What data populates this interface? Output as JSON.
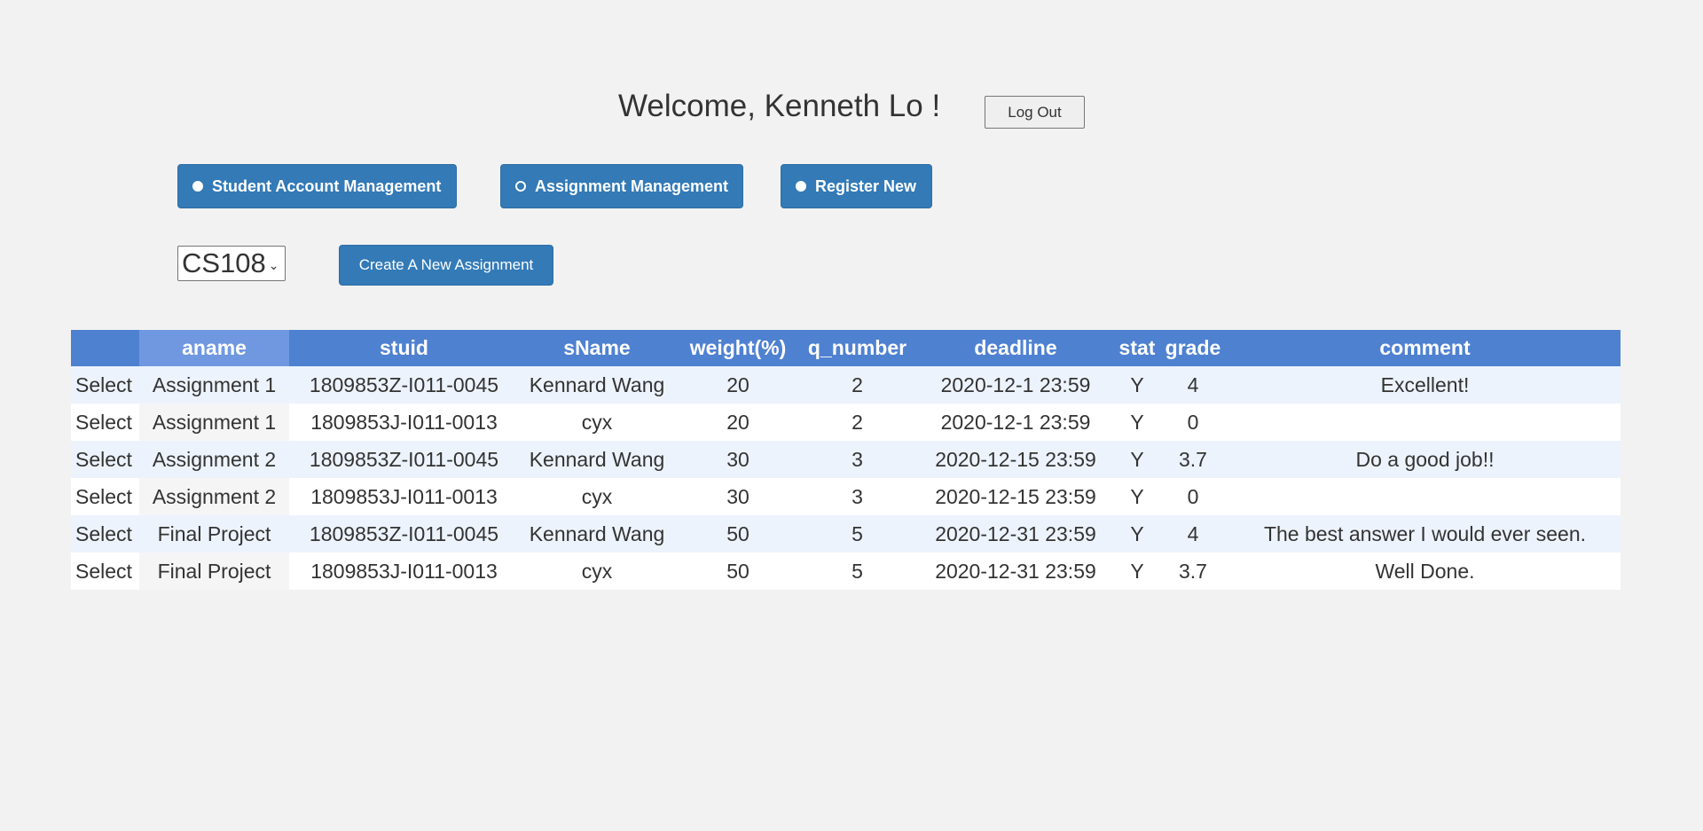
{
  "header": {
    "welcome": "Welcome, Kenneth Lo !",
    "logout_label": "Log Out"
  },
  "nav": {
    "student_account": "Student Account Management",
    "assignment": "Assignment Management",
    "register": "Register New"
  },
  "toolbar": {
    "course_selected": "CS108",
    "create_label": "Create A New Assignment"
  },
  "table": {
    "columns": [
      "",
      "aname",
      "stuid",
      "sName",
      "weight(%)",
      "q_number",
      "deadline",
      "stat",
      "grade",
      "comment"
    ],
    "select_label": "Select",
    "rows": [
      {
        "aname": "Assignment 1",
        "stuid": "1809853Z-I011-0045",
        "sname": "Kennard Wang",
        "weight": "20",
        "q_number": "2",
        "deadline": "2020-12-1 23:59",
        "stat": "Y",
        "grade": "4",
        "comment": "Excellent!"
      },
      {
        "aname": "Assignment 1",
        "stuid": "1809853J-I011-0013",
        "sname": "cyx",
        "weight": "20",
        "q_number": "2",
        "deadline": "2020-12-1 23:59",
        "stat": "Y",
        "grade": "0",
        "comment": ""
      },
      {
        "aname": "Assignment 2",
        "stuid": "1809853Z-I011-0045",
        "sname": "Kennard Wang",
        "weight": "30",
        "q_number": "3",
        "deadline": "2020-12-15 23:59",
        "stat": "Y",
        "grade": "3.7",
        "comment": "Do a good job!!"
      },
      {
        "aname": "Assignment 2",
        "stuid": "1809853J-I011-0013",
        "sname": "cyx",
        "weight": "30",
        "q_number": "3",
        "deadline": "2020-12-15 23:59",
        "stat": "Y",
        "grade": "0",
        "comment": ""
      },
      {
        "aname": "Final Project",
        "stuid": "1809853Z-I011-0045",
        "sname": "Kennard Wang",
        "weight": "50",
        "q_number": "5",
        "deadline": "2020-12-31 23:59",
        "stat": "Y",
        "grade": "4",
        "comment": "The best answer I would ever seen."
      },
      {
        "aname": "Final Project",
        "stuid": "1809853J-I011-0013",
        "sname": "cyx",
        "weight": "50",
        "q_number": "5",
        "deadline": "2020-12-31 23:59",
        "stat": "Y",
        "grade": "3.7",
        "comment": "Well Done."
      }
    ]
  },
  "colors": {
    "primary": "#337ab7",
    "table_header": "#4f81d1",
    "sorted_header": "#6f98e0",
    "row_alt": "#edf3fc",
    "background": "#f2f2f2"
  }
}
